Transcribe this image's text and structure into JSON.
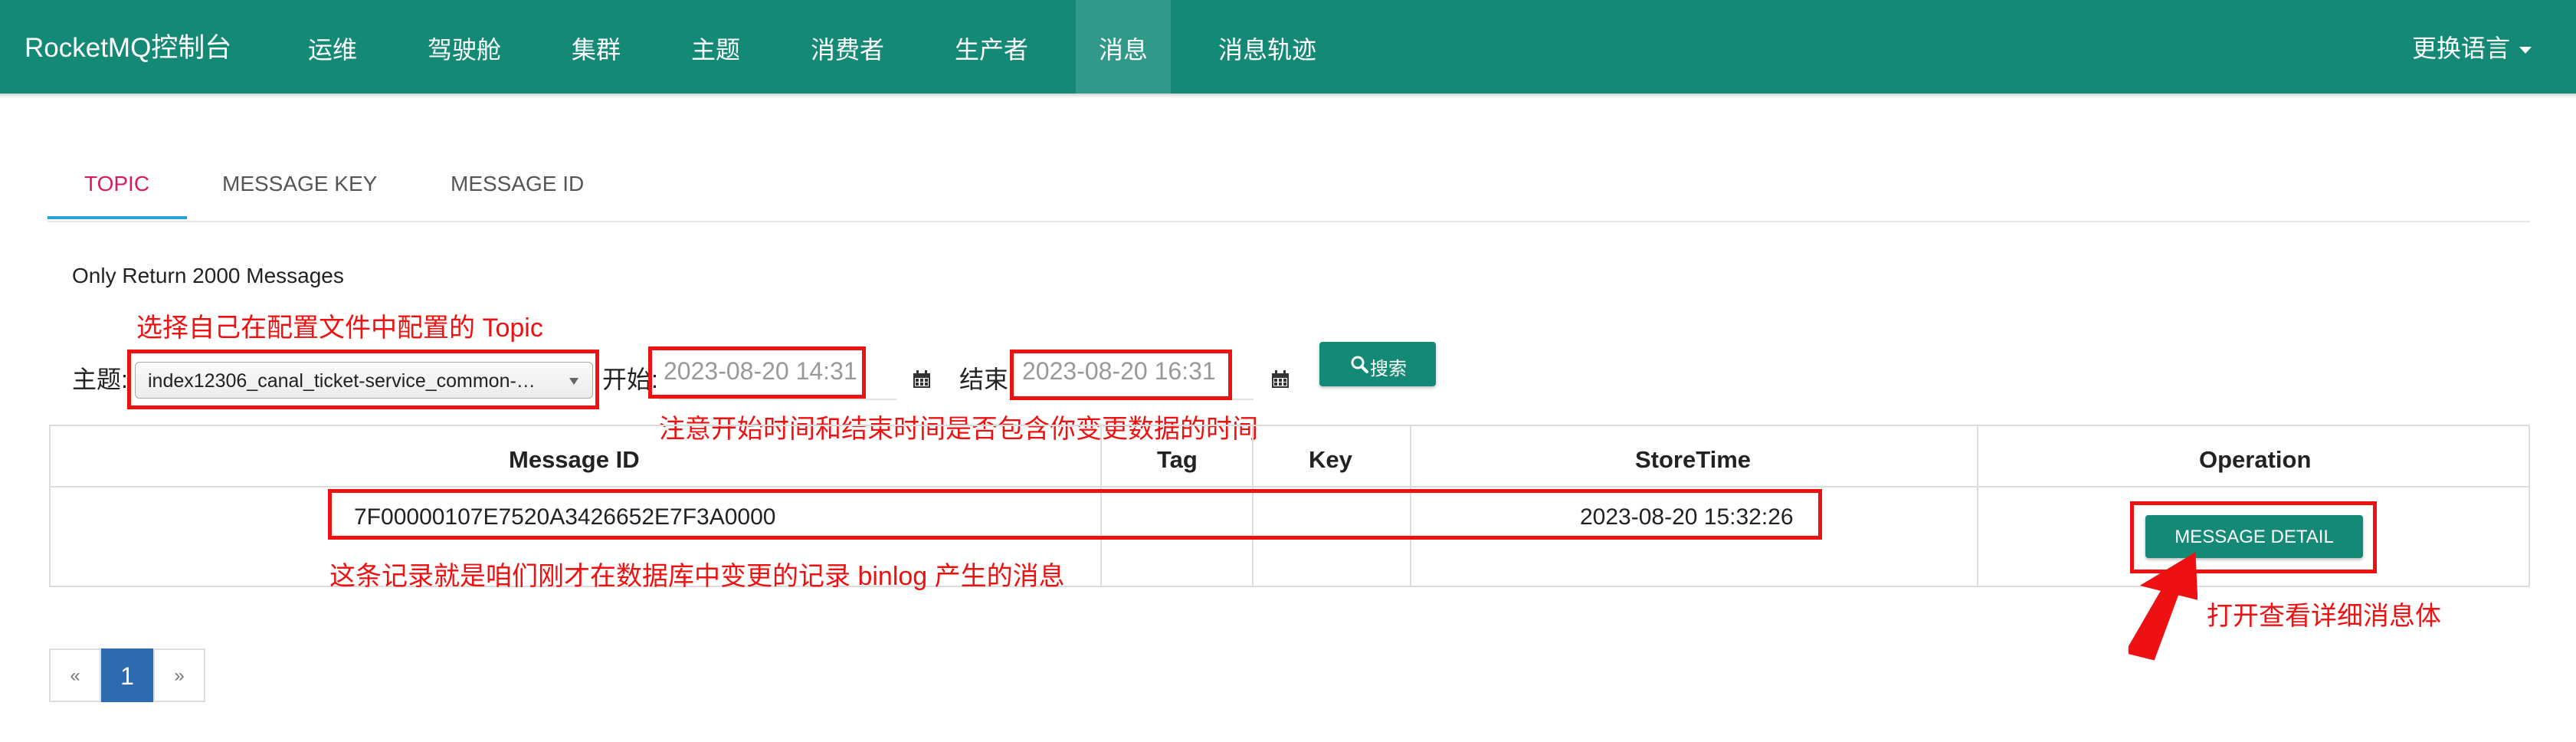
{
  "nav": {
    "brand": "RocketMQ控制台",
    "items": [
      "运维",
      "驾驶舱",
      "集群",
      "主题",
      "消费者",
      "生产者",
      "消息",
      "消息轨迹"
    ],
    "active": "消息",
    "language": "更换语言"
  },
  "tabs": [
    "TOPIC",
    "MESSAGE KEY",
    "MESSAGE ID"
  ],
  "active_tab": "TOPIC",
  "notice": "Only Return 2000 Messages",
  "form": {
    "topic_label": "主题:",
    "topic_value": "index12306_canal_ticket-service_common-…",
    "start_label": "开始:",
    "start_value": "2023-08-20 14:31",
    "end_label": "结束",
    "end_value": "2023-08-20 16:31",
    "search_label": "搜索"
  },
  "table": {
    "headers": [
      "Message ID",
      "Tag",
      "Key",
      "StoreTime",
      "Operation"
    ],
    "rows": [
      {
        "message_id": "7F00000107E7520A3426652E7F3A0000",
        "tag": "",
        "key": "",
        "store_time": "2023-08-20 15:32:26",
        "operation": "MESSAGE DETAIL"
      }
    ]
  },
  "annotations": {
    "topic_hint": "选择自己在配置文件中配置的 Topic",
    "time_hint": "注意开始时间和结束时间是否包含你变更数据的时间",
    "row_hint": "这条记录就是咱们刚才在数据库中变更的记录 binlog 产生的消息",
    "detail_hint": "打开查看详细消息体"
  },
  "pagination": {
    "prev": "«",
    "current": "1",
    "next": "»"
  },
  "colors": {
    "navbar": "#148a76",
    "active_tab": "#d81b60",
    "annotation": "#ee1111",
    "page_active": "#2c6bb0"
  }
}
